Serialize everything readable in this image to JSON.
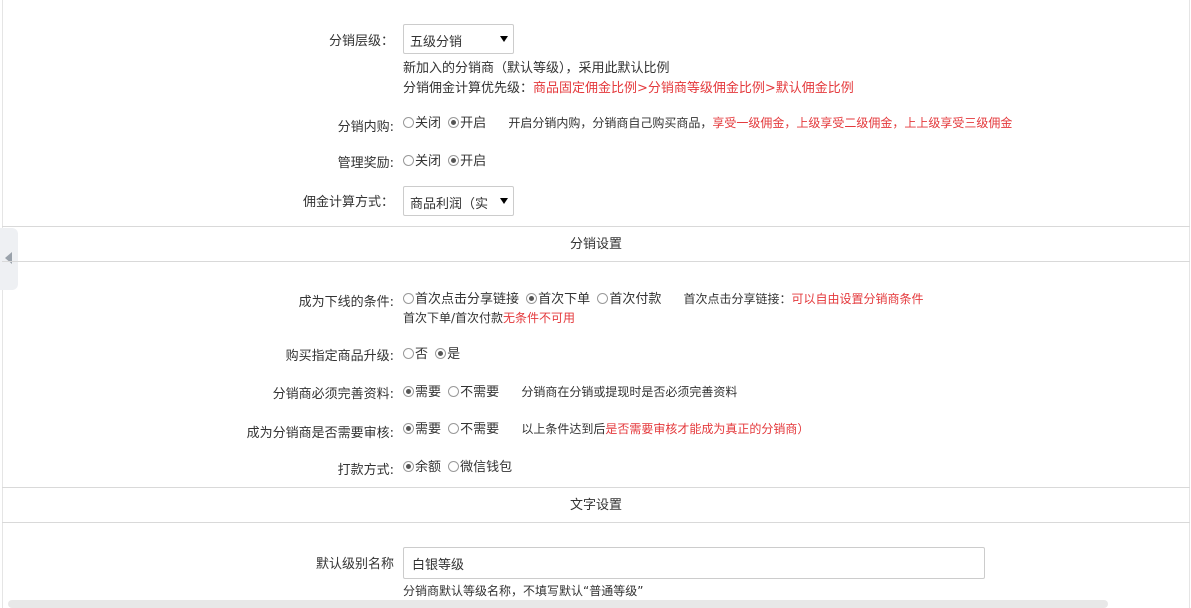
{
  "level": {
    "label": "分销层级：",
    "selected": "五级分销",
    "note1": "新加入的分销商（默认等级），采用此默认比例",
    "note2_prefix": "分销佣金计算优先级：",
    "note2_red": "商品固定佣金比例>分销商等级佣金比例>默认佣金比例"
  },
  "internal_purchase": {
    "label": "分销内购:",
    "opt_off": "关闭",
    "opt_on": "开启",
    "hint": "开启分销内购，分销商自己购买商品，",
    "hint_red": "享受一级佣金，上级享受二级佣金，上上级享受三级佣金"
  },
  "management_reward": {
    "label": "管理奖励:",
    "opt_off": "关闭",
    "opt_on": "开启"
  },
  "commission_method": {
    "label": "佣金计算方式：",
    "selected": "商品利润（实"
  },
  "section_distribution": "分销设置",
  "downline_condition": {
    "label": "成为下线的条件:",
    "opt1": "首次点击分享链接",
    "opt2": "首次下单",
    "opt3": "首次付款",
    "hint_prefix": "首次点击分享链接：",
    "hint_red": "可以自由设置分销商条件",
    "sub_prefix": "首次下单/首次付款",
    "sub_red": "无条件不可用"
  },
  "buy_upgrade": {
    "label": "购买指定商品升级:",
    "opt_no": "否",
    "opt_yes": "是"
  },
  "complete_profile": {
    "label": "分销商必须完善资料:",
    "opt_need": "需要",
    "opt_no_need": "不需要",
    "hint": "分销商在分销或提现时是否必须完善资料"
  },
  "need_review": {
    "label": "成为分销商是否需要审核:",
    "opt_need": "需要",
    "opt_no_need": "不需要",
    "hint_prefix": "以上条件达到后",
    "hint_red": "是否需要审核才能成为真正的分销商）"
  },
  "payout_method": {
    "label": "打款方式:",
    "opt_balance": "余额",
    "opt_wechat": "微信钱包"
  },
  "section_text": "文字设置",
  "default_level_name": {
    "label": "默认级别名称",
    "value": "白银等级",
    "hint": "分销商默认等级名称，不填写默认“普通等级”"
  }
}
